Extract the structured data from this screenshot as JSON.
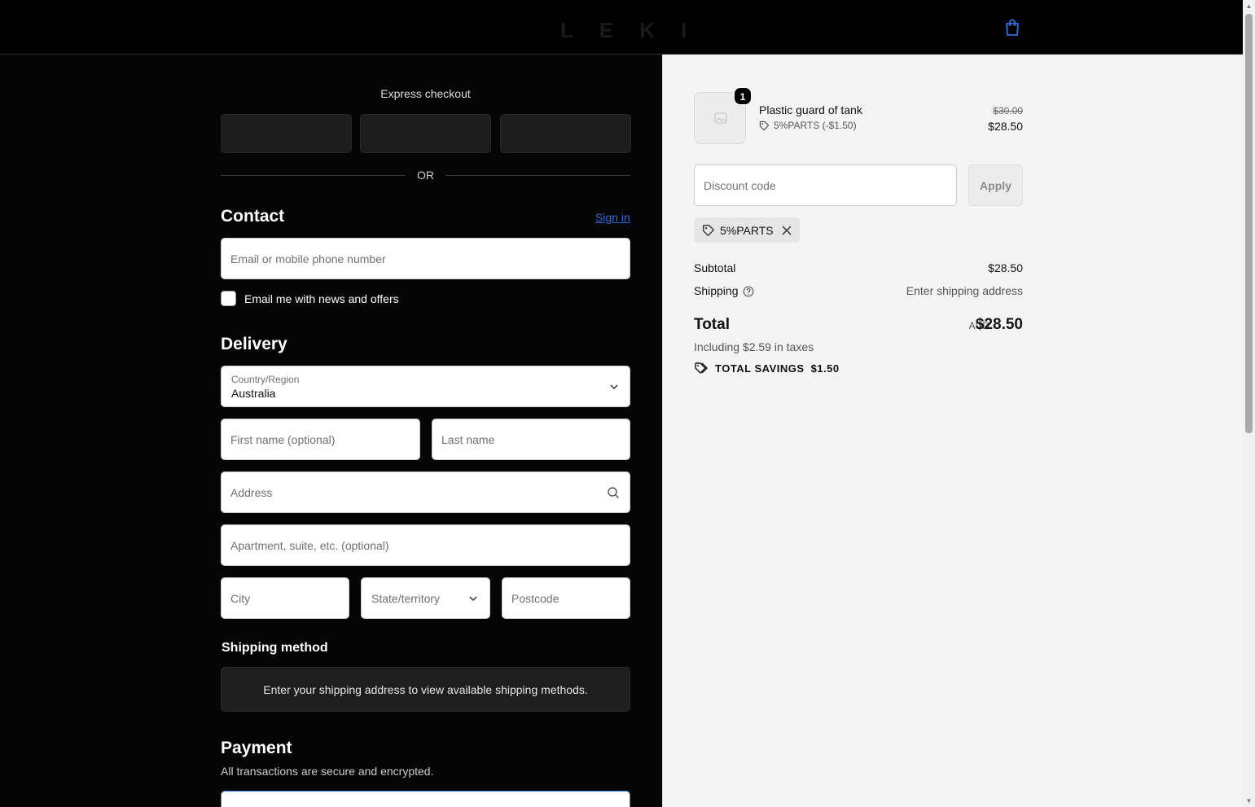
{
  "header": {
    "logo": "LEKI",
    "cart_icon": "shopping-bag-icon",
    "accent": "#2f6fe0"
  },
  "express": {
    "title": "Express checkout",
    "or": "OR"
  },
  "contact": {
    "title": "Contact",
    "signin": "Sign in",
    "email_placeholder": "Email or mobile phone number",
    "newsletter_label": "Email me with news and offers"
  },
  "delivery": {
    "title": "Delivery",
    "country_label": "Country/Region",
    "country_value": "Australia",
    "first_name_placeholder": "First name (optional)",
    "last_name_placeholder": "Last name",
    "address_placeholder": "Address",
    "apartment_placeholder": "Apartment, suite, etc. (optional)",
    "city_placeholder": "City",
    "state_placeholder": "State/territory",
    "postcode_placeholder": "Postcode"
  },
  "shipping_method": {
    "title": "Shipping method",
    "message": "Enter your shipping address to view available shipping methods."
  },
  "payment": {
    "title": "Payment",
    "subtitle": "All transactions are secure and encrypted."
  },
  "summary": {
    "item": {
      "quantity": "1",
      "name": "Plastic guard of tank",
      "discount": "5%PARTS (-$1.50)",
      "price_old": "$30.00",
      "price_new": "$28.50"
    },
    "discount_placeholder": "Discount code",
    "apply_label": "Apply",
    "applied_code": "5%PARTS",
    "subtotal_label": "Subtotal",
    "subtotal_value": "$28.50",
    "shipping_label": "Shipping",
    "shipping_value": "Enter shipping address",
    "total_label": "Total",
    "total_currency": "AUD",
    "total_value": "$28.50",
    "taxes": "Including $2.59 in taxes",
    "savings_label": "TOTAL SAVINGS",
    "savings_value": "$1.50"
  }
}
